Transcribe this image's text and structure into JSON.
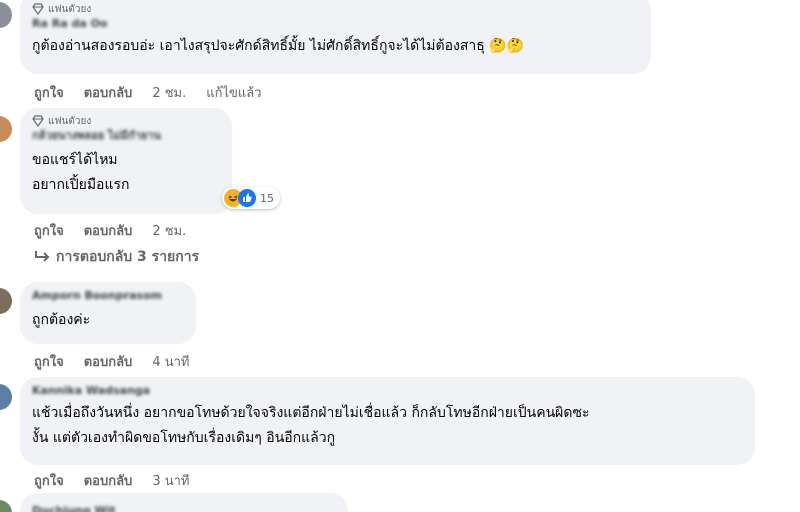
{
  "comments": [
    {
      "badge": "แฟนตัวยง",
      "author": "Ra Ra da Oo",
      "text_lines": [
        "กูต้องอ่านสองรอบอ่ะ เอาไงสรุปจะศักด์สิทธิ์มั้ย ไม่ศักดิ์สิทธิ์กูจะได้ไม่ต้องสาธุ 🤔🤔"
      ],
      "like": "ถูกใจ",
      "reply": "ตอบกลับ",
      "time": "2 ชม.",
      "edited": "แก้ไขแล้ว"
    },
    {
      "badge": "แฟนตัวยง",
      "author": "กล้วยนางพลอย ไม่มีกำยาน",
      "text_lines": [
        "ขอแชร์ได้ไหม",
        "อยากเปิ้ยมือแรก"
      ],
      "reaction_count": "15",
      "like": "ถูกใจ",
      "reply": "ตอบกลับ",
      "time": "2 ชม."
    },
    {
      "author": "Amporn Boonprasom",
      "text_lines": [
        "ถูกต้องค่ะ"
      ],
      "like": "ถูกใจ",
      "reply": "ตอบกลับ",
      "time": "4 นาที"
    },
    {
      "author": "Kannika Wadsanga",
      "text_lines": [
        "แช้วเมื่อถึงวันหนึ่ง อยากขอโทษด้วยใจจริงแต่อีกฝ่ายไม่เชื่อแล้ว ก็กลับโทษอีกฝ่ายเป็นคนผิดซะ",
        "งั้น แต่ตัวเองทำผิดขอโทษกับเรื่องเดิมๆ อินอีกแล้วกู"
      ],
      "like": "ถูกใจ",
      "reply": "ตอบกลับ",
      "time": "3 นาที"
    },
    {
      "author": "Duchjung Wit"
    }
  ],
  "replies_link": "การตอบกลับ 3 รายการ",
  "colors": {
    "bubble": "#f0f2f5",
    "secondary_text": "#65676b",
    "haha": "#f7b125",
    "like": "#1877f2"
  }
}
